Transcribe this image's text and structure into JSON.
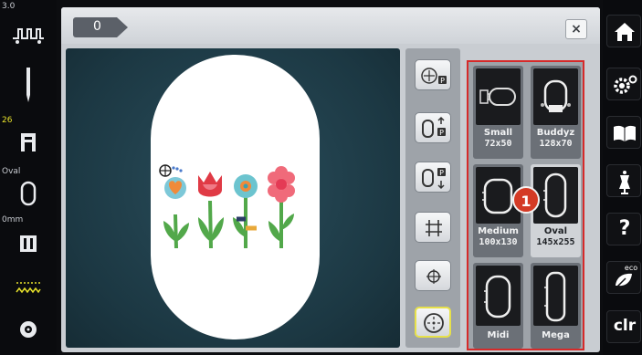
{
  "left_bar": {
    "stitch_width": "3.0",
    "needle_value": "26",
    "hoop_label": "Oval",
    "distance_value": "0mm"
  },
  "file_tab": {
    "label": "0"
  },
  "close_label": "×",
  "hoops": [
    {
      "name": "Small",
      "size": "72x50",
      "selected": false
    },
    {
      "name": "Buddyz",
      "size": "128x70",
      "selected": false
    },
    {
      "name": "Medium",
      "size": "100x130",
      "selected": false
    },
    {
      "name": "Oval",
      "size": "145x255",
      "selected": true
    },
    {
      "name": "Midi",
      "size": "",
      "selected": false
    },
    {
      "name": "Mega",
      "size": "",
      "selected": false
    }
  ],
  "callout": "1",
  "right_bar": {
    "eco_label": "eco",
    "clr_label": "clr",
    "help_label": "?"
  },
  "tool_badge": "P",
  "icons": [
    "home-icon",
    "settings-icon",
    "tutorial-book-icon",
    "dress-form-icon",
    "help-icon",
    "eco-icon",
    "clear-icon"
  ],
  "colors": {
    "accent_red": "#d62a2a",
    "selection_yellow": "#e7e14a",
    "stage_teal": "#1c3843"
  }
}
